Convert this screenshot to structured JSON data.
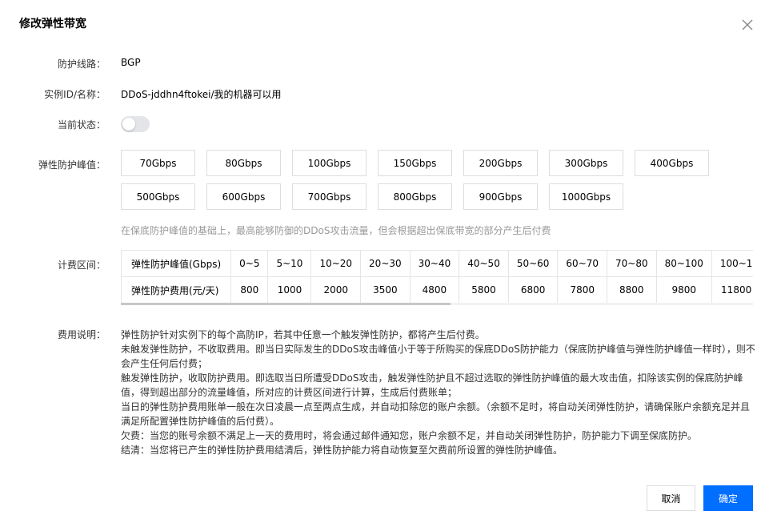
{
  "dialog": {
    "title": "修改弹性带宽",
    "close_icon": "close-icon"
  },
  "fields": {
    "route_label": "防护线路：",
    "route_value": "BGP",
    "instance_label": "实例ID/名称：",
    "instance_value": "DDoS-jddhn4ftokei/我的机器可以用",
    "status_label": "当前状态：",
    "status_on": false,
    "peak_label": "弹性防护峰值：",
    "billing_label": "计费区间：",
    "desc_label": "费用说明："
  },
  "peak_options": [
    "70Gbps",
    "80Gbps",
    "100Gbps",
    "150Gbps",
    "200Gbps",
    "300Gbps",
    "400Gbps",
    "500Gbps",
    "600Gbps",
    "700Gbps",
    "800Gbps",
    "900Gbps",
    "1000Gbps"
  ],
  "peak_hint": "在保底防护峰值的基础上，最高能够防御的DDoS攻击流量，但会根据超出保底带宽的部分产生后付费",
  "billing_table": {
    "row1_header": "弹性防护峰值(Gbps)",
    "ranges": [
      "0~5",
      "5~10",
      "10~20",
      "20~30",
      "30~40",
      "40~50",
      "50~60",
      "60~70",
      "70~80",
      "80~100",
      "100~1"
    ],
    "row2_header": "弹性防护费用(元/天)",
    "prices": [
      "800",
      "1000",
      "2000",
      "3500",
      "4800",
      "5800",
      "6800",
      "7800",
      "8800",
      "9800",
      "11800"
    ]
  },
  "description": [
    "弹性防护针对实例下的每个高防IP，若其中任意一个触发弹性防护，都将产生后付费。",
    "未触发弹性防护，不收取费用。即当日实际发生的DDoS攻击峰值小于等于所购买的保底DDoS防护能力（保底防护峰值与弹性防护峰值一样时），则不会产生任何后付费；",
    "触发弹性防护，收取防护费用。即选取当日所遭受DDoS攻击，触发弹性防护且不超过选取的弹性防护峰值的最大攻击值，扣除该实例的保底防护峰值，得到超出部分的流量峰值，所对应的计费区间进行计算，生成后付费账单；",
    "当日的弹性防护费用账单一般在次日凌晨一点至两点生成，并自动扣除您的账户余额。（余额不足时，将自动关闭弹性防护，请确保账户余额充足并且满足所配置弹性防护峰值的后付费）。",
    "欠费：当您的账号余额不满足上一天的费用时，将会通过邮件通知您，账户余额不足，并自动关闭弹性防护，防护能力下调至保底防护。",
    "结清：当您将已产生的弹性防护费用结清后，弹性防护能力将自动恢复至欠费前所设置的弹性防护峰值。"
  ],
  "buttons": {
    "cancel": "取消",
    "confirm": "确定"
  },
  "colors": {
    "primary": "#006eff",
    "border": "#dddddd",
    "hint": "#999999"
  }
}
